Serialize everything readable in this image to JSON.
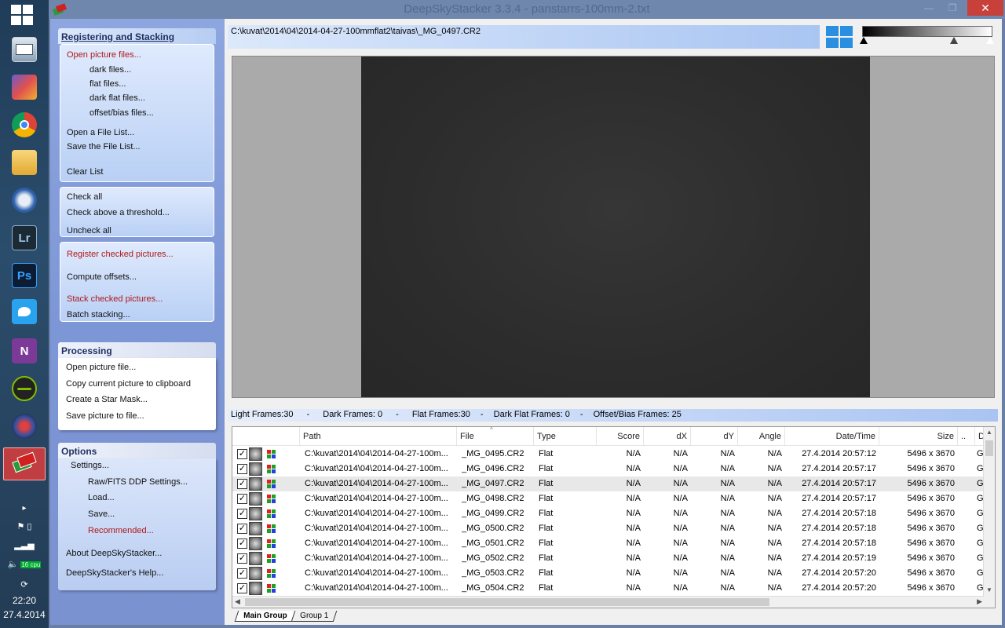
{
  "window": {
    "title": "DeepSkyStacker 3.3.4 - panstarrs-100mm-2.txt",
    "close_glyph": "✕",
    "min_glyph": "—",
    "max_glyph": "❐"
  },
  "taskbar": {
    "apps": [
      {
        "name": "task-manager",
        "label": ""
      },
      {
        "name": "mplayer",
        "label": ""
      },
      {
        "name": "chrome",
        "label": ""
      },
      {
        "name": "file-explorer",
        "label": ""
      },
      {
        "name": "thunderbird",
        "label": ""
      },
      {
        "name": "lightroom",
        "label": "Lr"
      },
      {
        "name": "photoshop",
        "label": "Ps"
      },
      {
        "name": "twitter",
        "label": ""
      },
      {
        "name": "onenote",
        "label": "N"
      },
      {
        "name": "spotify",
        "label": ""
      },
      {
        "name": "stellarium",
        "label": ""
      },
      {
        "name": "deepskystacker",
        "label": ""
      }
    ],
    "tray": {
      "cpu_badge": "16 cpu",
      "time": "22:20",
      "date": "27.4.2014"
    }
  },
  "left_panel": {
    "registering": {
      "header": "Registering and Stacking",
      "open_picture_files": "Open picture files...",
      "dark_files": "dark files...",
      "flat_files": "flat files...",
      "dark_flat_files": "dark flat files...",
      "offset_bias_files": "offset/bias files...",
      "open_file_list": "Open a File List...",
      "save_file_list": "Save the File List...",
      "clear_list": "Clear List",
      "check_all": "Check all",
      "check_above_threshold": "Check above a threshold...",
      "uncheck_all": "Uncheck all",
      "register_checked": "Register checked pictures...",
      "compute_offsets": "Compute offsets...",
      "stack_checked": "Stack checked pictures...",
      "batch_stacking": "Batch stacking..."
    },
    "processing": {
      "header": "Processing",
      "open_picture_file": "Open picture file...",
      "copy_to_clipboard": "Copy current picture to clipboard",
      "create_star_mask": "Create a Star Mask...",
      "save_picture": "Save picture to file..."
    },
    "options": {
      "header": "Options",
      "settings": "Settings...",
      "raw_fits": "Raw/FITS DDP Settings...",
      "load": "Load...",
      "save": "Save...",
      "recommended": "Recommended...",
      "about": "About DeepSkyStacker...",
      "help": "DeepSkyStacker's Help..."
    }
  },
  "viewer": {
    "current_path": "C:\\kuvat\\2014\\04\\2014-04-27-100mmflat2\\taivas\\_MG_0497.CR2"
  },
  "stats": {
    "light": "Light Frames:30",
    "sep": "-",
    "dark": "Dark Frames: 0",
    "flat": "Flat Frames:30",
    "dark_flat": "Dark Flat Frames: 0",
    "offset_bias": "Offset/Bias Frames: 25"
  },
  "table": {
    "headers": [
      "Path",
      "File",
      "Type",
      "Score",
      "dX",
      "dY",
      "Angle",
      "Date/Time",
      "Size",
      "..",
      "D"
    ],
    "check_glyph": "✓",
    "rows": [
      {
        "path": "C:\\kuvat\\2014\\04\\2014-04-27-100m...",
        "file": "_MG_0495.CR2",
        "type": "Flat",
        "score": "N/A",
        "dx": "N/A",
        "dy": "N/A",
        "angle": "N/A",
        "datetime": "27.4.2014 20:57:12",
        "size": "5496 x 3670",
        "extra": "",
        "d": "G"
      },
      {
        "path": "C:\\kuvat\\2014\\04\\2014-04-27-100m...",
        "file": "_MG_0496.CR2",
        "type": "Flat",
        "score": "N/A",
        "dx": "N/A",
        "dy": "N/A",
        "angle": "N/A",
        "datetime": "27.4.2014 20:57:17",
        "size": "5496 x 3670",
        "extra": "",
        "d": "G"
      },
      {
        "path": "C:\\kuvat\\2014\\04\\2014-04-27-100m...",
        "file": "_MG_0497.CR2",
        "type": "Flat",
        "score": "N/A",
        "dx": "N/A",
        "dy": "N/A",
        "angle": "N/A",
        "datetime": "27.4.2014 20:57:17",
        "size": "5496 x 3670",
        "extra": "",
        "d": "G"
      },
      {
        "path": "C:\\kuvat\\2014\\04\\2014-04-27-100m...",
        "file": "_MG_0498.CR2",
        "type": "Flat",
        "score": "N/A",
        "dx": "N/A",
        "dy": "N/A",
        "angle": "N/A",
        "datetime": "27.4.2014 20:57:17",
        "size": "5496 x 3670",
        "extra": "",
        "d": "G"
      },
      {
        "path": "C:\\kuvat\\2014\\04\\2014-04-27-100m...",
        "file": "_MG_0499.CR2",
        "type": "Flat",
        "score": "N/A",
        "dx": "N/A",
        "dy": "N/A",
        "angle": "N/A",
        "datetime": "27.4.2014 20:57:18",
        "size": "5496 x 3670",
        "extra": "",
        "d": "G"
      },
      {
        "path": "C:\\kuvat\\2014\\04\\2014-04-27-100m...",
        "file": "_MG_0500.CR2",
        "type": "Flat",
        "score": "N/A",
        "dx": "N/A",
        "dy": "N/A",
        "angle": "N/A",
        "datetime": "27.4.2014 20:57:18",
        "size": "5496 x 3670",
        "extra": "",
        "d": "G"
      },
      {
        "path": "C:\\kuvat\\2014\\04\\2014-04-27-100m...",
        "file": "_MG_0501.CR2",
        "type": "Flat",
        "score": "N/A",
        "dx": "N/A",
        "dy": "N/A",
        "angle": "N/A",
        "datetime": "27.4.2014 20:57:18",
        "size": "5496 x 3670",
        "extra": "",
        "d": "G"
      },
      {
        "path": "C:\\kuvat\\2014\\04\\2014-04-27-100m...",
        "file": "_MG_0502.CR2",
        "type": "Flat",
        "score": "N/A",
        "dx": "N/A",
        "dy": "N/A",
        "angle": "N/A",
        "datetime": "27.4.2014 20:57:19",
        "size": "5496 x 3670",
        "extra": "",
        "d": "G"
      },
      {
        "path": "C:\\kuvat\\2014\\04\\2014-04-27-100m...",
        "file": "_MG_0503.CR2",
        "type": "Flat",
        "score": "N/A",
        "dx": "N/A",
        "dy": "N/A",
        "angle": "N/A",
        "datetime": "27.4.2014 20:57:20",
        "size": "5496 x 3670",
        "extra": "",
        "d": "G"
      },
      {
        "path": "C:\\kuvat\\2014\\04\\2014-04-27-100m...",
        "file": "_MG_0504.CR2",
        "type": "Flat",
        "score": "N/A",
        "dx": "N/A",
        "dy": "N/A",
        "angle": "N/A",
        "datetime": "27.4.2014 20:57:20",
        "size": "5496 x 3670",
        "extra": "",
        "d": "G"
      }
    ]
  },
  "tabs": [
    "Main Group",
    "Group 1"
  ],
  "colors": {
    "accent_red": "#b01818",
    "panel_blue": "#8ea6df",
    "close_red": "#c7403a",
    "selected_taskbar": "#dc3c3c"
  }
}
